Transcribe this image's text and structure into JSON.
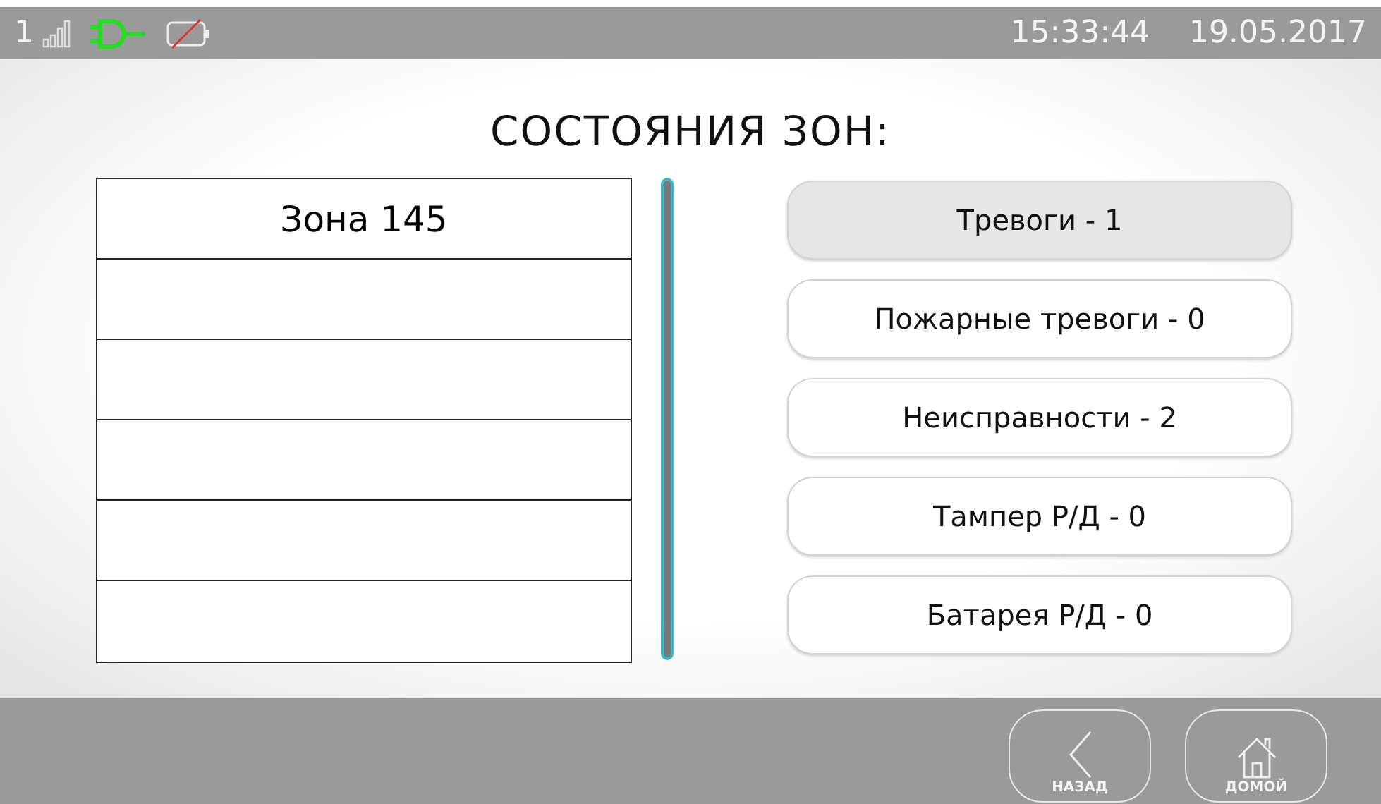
{
  "status_bar": {
    "sim": "1",
    "time": "15:33:44",
    "date": "19.05.2017"
  },
  "title": "СОСТОЯНИЯ ЗОН:",
  "zones": [
    {
      "label": "Зона 145"
    }
  ],
  "categories": [
    {
      "label": "Тревоги - 1",
      "selected": true
    },
    {
      "label": "Пожарные тревоги - 0",
      "selected": false
    },
    {
      "label": "Неисправности - 2",
      "selected": false
    },
    {
      "label": "Тампер Р/Д - 0",
      "selected": false
    },
    {
      "label": "Батарея Р/Д - 0",
      "selected": false
    }
  ],
  "nav": [
    {
      "kind": "back",
      "label": "НАЗАД"
    },
    {
      "kind": "home",
      "label": "ДОМОЙ"
    }
  ]
}
